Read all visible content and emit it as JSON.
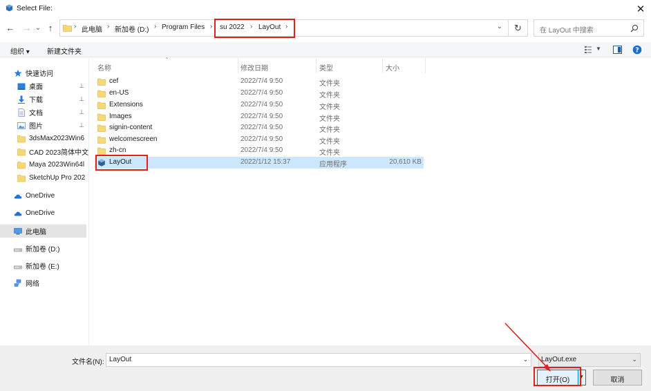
{
  "window": {
    "title": "Select File:",
    "close_glyph": "✕"
  },
  "nav": {
    "back_glyph": "←",
    "forward_glyph": "→",
    "recent_glyph": "⌄",
    "up_glyph": "↑",
    "breadcrumbs": [
      "此电脑",
      "新加卷 (D:)",
      "Program Files",
      "su 2022",
      "LayOut"
    ],
    "separator": "›",
    "address_dropdown_glyph": "⌄",
    "refresh_glyph": "↻",
    "search_placeholder": "在 LayOut 中搜索"
  },
  "toolbar": {
    "organize_label": "组织 ▾",
    "new_folder_label": "新建文件夹"
  },
  "sidebar": {
    "items": [
      {
        "label": "快速访问",
        "icon": "star-icon"
      },
      {
        "label": "桌面",
        "icon": "desktop-icon",
        "pinned": true
      },
      {
        "label": "下载",
        "icon": "download-icon",
        "pinned": true
      },
      {
        "label": "文档",
        "icon": "document-icon",
        "pinned": true
      },
      {
        "label": "图片",
        "icon": "pictures-icon",
        "pinned": true
      },
      {
        "label": "3dsMax2023Win6",
        "icon": "folder-icon"
      },
      {
        "label": "CAD 2023简体中文",
        "icon": "folder-icon"
      },
      {
        "label": "Maya 2023Win64l",
        "icon": "folder-icon"
      },
      {
        "label": "SketchUp Pro 202",
        "icon": "folder-icon"
      },
      {
        "label": "OneDrive",
        "icon": "cloud-icon"
      },
      {
        "label": "OneDrive",
        "icon": "cloud-icon"
      },
      {
        "label": "此电脑",
        "icon": "computer-icon"
      },
      {
        "label": "新加卷 (D:)",
        "icon": "drive-icon"
      },
      {
        "label": "新加卷 (E:)",
        "icon": "drive-icon"
      },
      {
        "label": "网络",
        "icon": "network-icon"
      }
    ],
    "pin_glyph": "📌"
  },
  "columns": {
    "name": "名称",
    "modified": "修改日期",
    "type": "类型",
    "size": "大小"
  },
  "files": [
    {
      "name": "cef",
      "modified": "2022/7/4 9:50",
      "type": "文件夹",
      "size": "",
      "icon": "folder-icon"
    },
    {
      "name": "en-US",
      "modified": "2022/7/4 9:50",
      "type": "文件夹",
      "size": "",
      "icon": "folder-icon"
    },
    {
      "name": "Extensions",
      "modified": "2022/7/4 9:50",
      "type": "文件夹",
      "size": "",
      "icon": "folder-icon"
    },
    {
      "name": "Images",
      "modified": "2022/7/4 9:50",
      "type": "文件夹",
      "size": "",
      "icon": "folder-icon"
    },
    {
      "name": "signin-content",
      "modified": "2022/7/4 9:50",
      "type": "文件夹",
      "size": "",
      "icon": "folder-icon"
    },
    {
      "name": "welcomescreen",
      "modified": "2022/7/4 9:50",
      "type": "文件夹",
      "size": "",
      "icon": "folder-icon"
    },
    {
      "name": "zh-cn",
      "modified": "2022/7/4 9:50",
      "type": "文件夹",
      "size": "",
      "icon": "folder-icon"
    },
    {
      "name": "LayOut",
      "modified": "2022/1/12 15:37",
      "type": "应用程序",
      "size": "20,610 KB",
      "icon": "layout-app-icon",
      "selected": true
    }
  ],
  "bottom": {
    "filename_label": "文件名(N):",
    "filename_value": "LayOut",
    "filter_value": "LayOut.exe",
    "dropdown_glyph": "⌄",
    "open_label": "打开(O)",
    "open_dropdown_glyph": "▾",
    "cancel_label": "取消"
  },
  "colors": {
    "accent": "#0078d7",
    "selection": "#cce8ff",
    "highlight_red": "#e0201a",
    "folder": "#f8d775"
  }
}
